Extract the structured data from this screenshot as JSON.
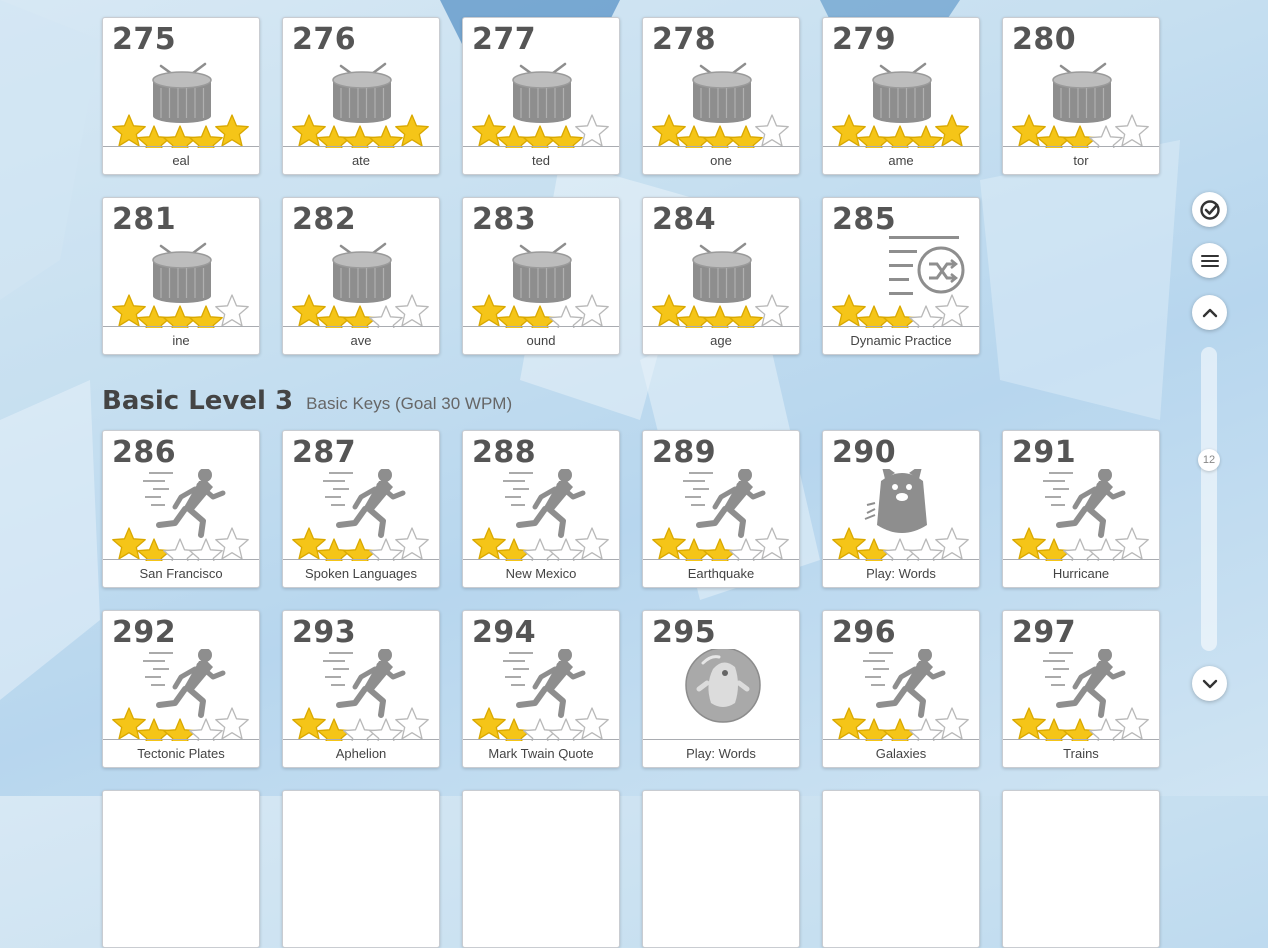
{
  "colors": {
    "star_filled": "#f5c518",
    "star_empty": "#ffffff",
    "icon_gray": "#8e8e8e"
  },
  "row1": [
    {
      "number": "275",
      "title": "eal",
      "icon": "drum-icon",
      "stars": 5
    },
    {
      "number": "276",
      "title": "ate",
      "icon": "drum-icon",
      "stars": 5
    },
    {
      "number": "277",
      "title": "ted",
      "icon": "drum-icon",
      "stars": 4
    },
    {
      "number": "278",
      "title": "one",
      "icon": "drum-icon",
      "stars": 4
    },
    {
      "number": "279",
      "title": "ame",
      "icon": "drum-icon",
      "stars": 5
    },
    {
      "number": "280",
      "title": "tor",
      "icon": "drum-icon",
      "stars": 3
    }
  ],
  "row2": [
    {
      "number": "281",
      "title": "ine",
      "icon": "drum-icon",
      "stars": 4
    },
    {
      "number": "282",
      "title": "ave",
      "icon": "drum-icon",
      "stars": 3
    },
    {
      "number": "283",
      "title": "ound",
      "icon": "drum-icon",
      "stars": 3
    },
    {
      "number": "284",
      "title": "age",
      "icon": "drum-icon",
      "stars": 4
    },
    {
      "number": "285",
      "title": "Dynamic Practice",
      "icon": "shuffle-list-icon",
      "stars": 3
    }
  ],
  "section": {
    "title": "Basic Level 3",
    "subtitle": "Basic Keys (Goal 30 WPM)"
  },
  "row3": [
    {
      "number": "286",
      "title": "San Francisco",
      "icon": "runner-icon",
      "stars": 2
    },
    {
      "number": "287",
      "title": "Spoken Languages",
      "icon": "runner-icon",
      "stars": 3
    },
    {
      "number": "288",
      "title": "New Mexico",
      "icon": "runner-icon",
      "stars": 2
    },
    {
      "number": "289",
      "title": "Earthquake",
      "icon": "runner-icon",
      "stars": 3
    },
    {
      "number": "290",
      "title": "Play: Words",
      "icon": "monster-icon",
      "stars": 2
    },
    {
      "number": "291",
      "title": "Hurricane",
      "icon": "runner-icon",
      "stars": 2
    }
  ],
  "row4": [
    {
      "number": "292",
      "title": "Tectonic Plates",
      "icon": "runner-icon",
      "stars": 3
    },
    {
      "number": "293",
      "title": "Aphelion",
      "icon": "runner-icon",
      "stars": 2
    },
    {
      "number": "294",
      "title": "Mark Twain Quote",
      "icon": "runner-icon",
      "stars": 2
    },
    {
      "number": "295",
      "title": "Play: Words",
      "icon": "bubble-creature-icon",
      "stars": 0
    },
    {
      "number": "296",
      "title": "Galaxies",
      "icon": "runner-icon",
      "stars": 3
    },
    {
      "number": "297",
      "title": "Trains",
      "icon": "runner-icon",
      "stars": 3
    }
  ],
  "sidebar": {
    "progress_icon": "checkmark-circle-icon",
    "menu_icon": "hamburger-menu-icon",
    "up_icon": "chevron-up-icon",
    "down_icon": "chevron-down-icon",
    "scroll_label": "12"
  }
}
